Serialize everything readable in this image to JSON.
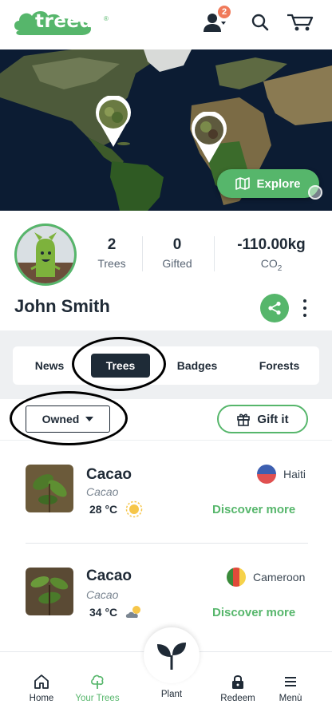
{
  "header": {
    "logo_text": "treedom",
    "logo_mark": "®",
    "notifications_count": "2",
    "icons": [
      "user-icon",
      "search-icon",
      "cart-icon"
    ]
  },
  "map": {
    "explore_label": "Explore"
  },
  "profile": {
    "name": "John Smith",
    "stats": [
      {
        "value": "2",
        "label": "Trees"
      },
      {
        "value": "0",
        "label": "Gifted"
      },
      {
        "value": "-110.00kg",
        "label": "CO",
        "label_sub": "2"
      }
    ]
  },
  "tabs": [
    {
      "label": "News",
      "active": false
    },
    {
      "label": "Trees",
      "active": true
    },
    {
      "label": "Badges",
      "active": false
    },
    {
      "label": "Forests",
      "active": false
    }
  ],
  "filter": {
    "selected": "Owned",
    "gift_label": "Gift it"
  },
  "trees": [
    {
      "name": "Cacao",
      "species": "Cacao",
      "temp": "28 °C",
      "weather": "sunny-icon",
      "country": "Haiti",
      "link": "Discover more"
    },
    {
      "name": "Cacao",
      "species": "Cacao",
      "temp": "34 °C",
      "weather": "partly-cloudy-icon",
      "country": "Cameroon",
      "link": "Discover more"
    }
  ],
  "bottom_nav": {
    "home": "Home",
    "your_trees": "Your Trees",
    "plant": "Plant",
    "redeem": "Redeem",
    "menu": "Menù"
  },
  "colors": {
    "brand_green": "#56b66b",
    "dark": "#1e2b37",
    "badge": "#f07a5a"
  }
}
